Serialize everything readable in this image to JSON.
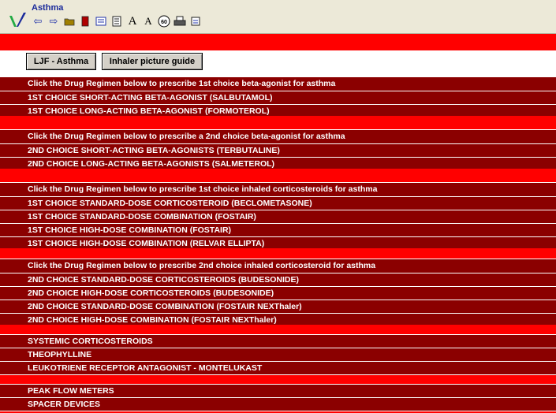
{
  "app": {
    "title": "Asthma"
  },
  "toolbar_icons": [
    "back-arrow-icon",
    "forward-arrow-icon",
    "folder-icon",
    "book-icon",
    "index-icon",
    "contents-icon",
    "font-increase-icon",
    "font-decrease-icon",
    "sixty-icon",
    "print-icon",
    "export-icon"
  ],
  "buttons": {
    "ljf": "LJF - Asthma",
    "inhaler": "Inhaler picture guide"
  },
  "sections": [
    {
      "heading": "Click the Drug Regimen below to prescribe 1st choice beta-agonist for asthma",
      "items": [
        "1ST CHOICE SHORT-ACTING BETA-AGONIST (SALBUTAMOL)",
        "1ST CHOICE LONG-ACTING BETA-AGONIST (FORMOTEROL)"
      ]
    },
    {
      "heading": "Click the Drug Regimen below to prescribe a 2nd choice beta-agonist for asthma",
      "items": [
        "2ND CHOICE SHORT-ACTING BETA-AGONISTS (TERBUTALINE)",
        "2ND CHOICE LONG-ACTING BETA-AGONISTS (SALMETEROL)"
      ]
    },
    {
      "heading": "Click the Drug Regimen below to prescribe 1st choice inhaled corticosteroids for asthma",
      "items": [
        "1ST CHOICE STANDARD-DOSE CORTICOSTEROID (BECLOMETASONE)",
        "1ST CHOICE STANDARD-DOSE COMBINATION (FOSTAIR)",
        "1ST CHOICE HIGH-DOSE COMBINATION (FOSTAIR)",
        "1ST CHOICE HIGH-DOSE COMBINATION (RELVAR ELLIPTA)"
      ]
    },
    {
      "heading": "Click the Drug Regimen below to prescribe 2nd choice inhaled corticosteroid for asthma",
      "items": [
        "2ND CHOICE STANDARD-DOSE CORTICOSTEROIDS (BUDESONIDE)",
        "2ND CHOICE HIGH-DOSE CORTICOSTEROIDS (BUDESONIDE)",
        "2ND CHOICE STANDARD-DOSE COMBINATION (FOSTAIR NEXThaler)",
        "2ND CHOICE HIGH-DOSE COMBINATION (FOSTAIR NEXThaler)"
      ]
    },
    {
      "heading": "",
      "items": [
        "SYSTEMIC CORTICOSTEROIDS",
        "THEOPHYLLINE",
        "LEUKOTRIENE RECEPTOR ANTAGONIST - MONTELUKAST"
      ]
    },
    {
      "heading": "",
      "items": [
        "PEAK FLOW METERS",
        "SPACER DEVICES"
      ]
    }
  ]
}
